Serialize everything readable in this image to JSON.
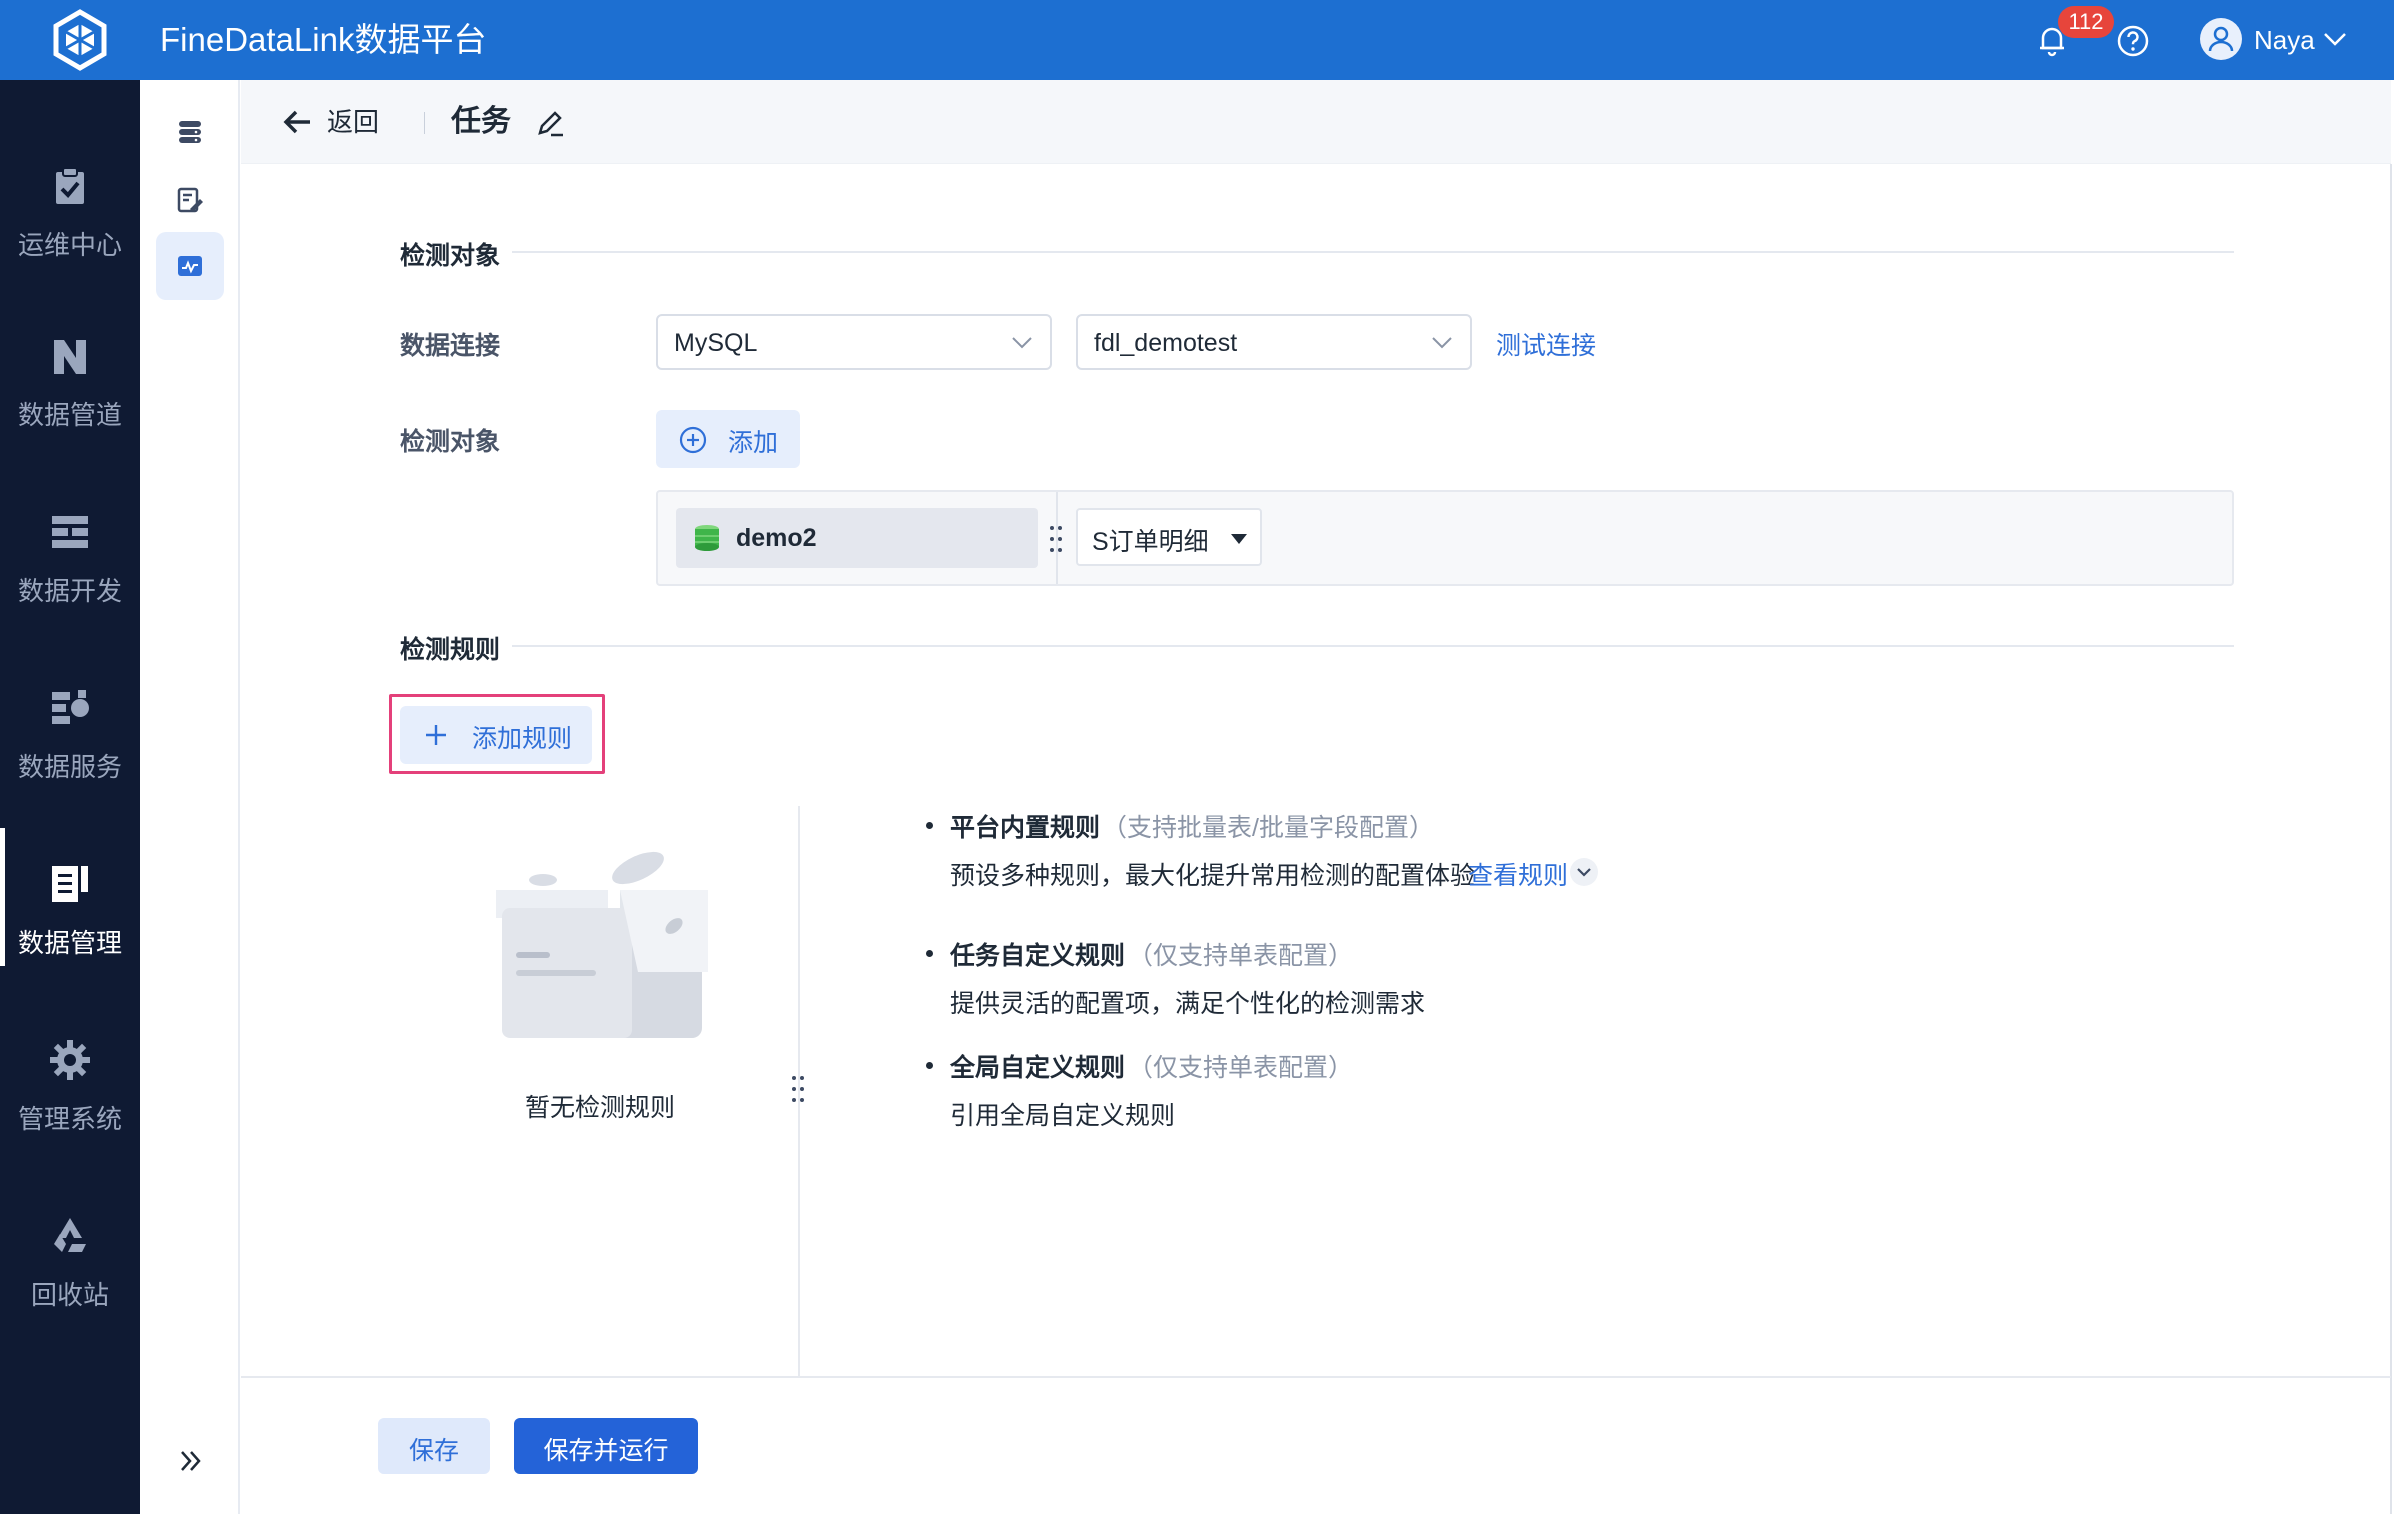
{
  "app": {
    "title": "FineDataLink数据平台",
    "notifications": "112",
    "user": "Naya"
  },
  "nav": {
    "items": [
      {
        "label": "运维中心",
        "icon": "clipboard-check-icon"
      },
      {
        "label": "数据管道",
        "icon": "pipeline-icon"
      },
      {
        "label": "数据开发",
        "icon": "develop-icon"
      },
      {
        "label": "数据服务",
        "icon": "service-icon"
      },
      {
        "label": "数据管理",
        "icon": "data-management-icon",
        "active": true
      },
      {
        "label": "管理系统",
        "icon": "gear-icon"
      },
      {
        "label": "回收站",
        "icon": "recycle-icon"
      }
    ]
  },
  "header": {
    "back": "返回",
    "title": "任务"
  },
  "section1": {
    "title": "检测对象",
    "conn_label": "数据连接",
    "db_type": "MySQL",
    "conn_name": "fdl_demotest",
    "test_link": "测试连接",
    "obj_label": "检测对象",
    "add": "添加",
    "db": "demo2",
    "table": "S订单明细"
  },
  "section2": {
    "title": "检测规则",
    "add_rule": "添加规则",
    "empty": "暂无检测规则",
    "rules": [
      {
        "name": "平台内置规则",
        "note": "（支持批量表/批量字段配置）",
        "desc": "预设多种规则，最大化提升常用检测的配置体验",
        "link": "查看规则"
      },
      {
        "name": "任务自定义规则",
        "note": "（仅支持单表配置）",
        "desc": "提供灵活的配置项，满足个性化的检测需求"
      },
      {
        "name": "全局自定义规则",
        "note": "（仅支持单表配置）",
        "desc": "引用全局自定义规则"
      }
    ]
  },
  "footer": {
    "save": "保存",
    "save_run": "保存并运行"
  },
  "colors": {
    "topbar": "#1d6fd1",
    "nav_bg": "#0f1a33",
    "primary": "#2463d8",
    "highlight": "#e4407a"
  }
}
